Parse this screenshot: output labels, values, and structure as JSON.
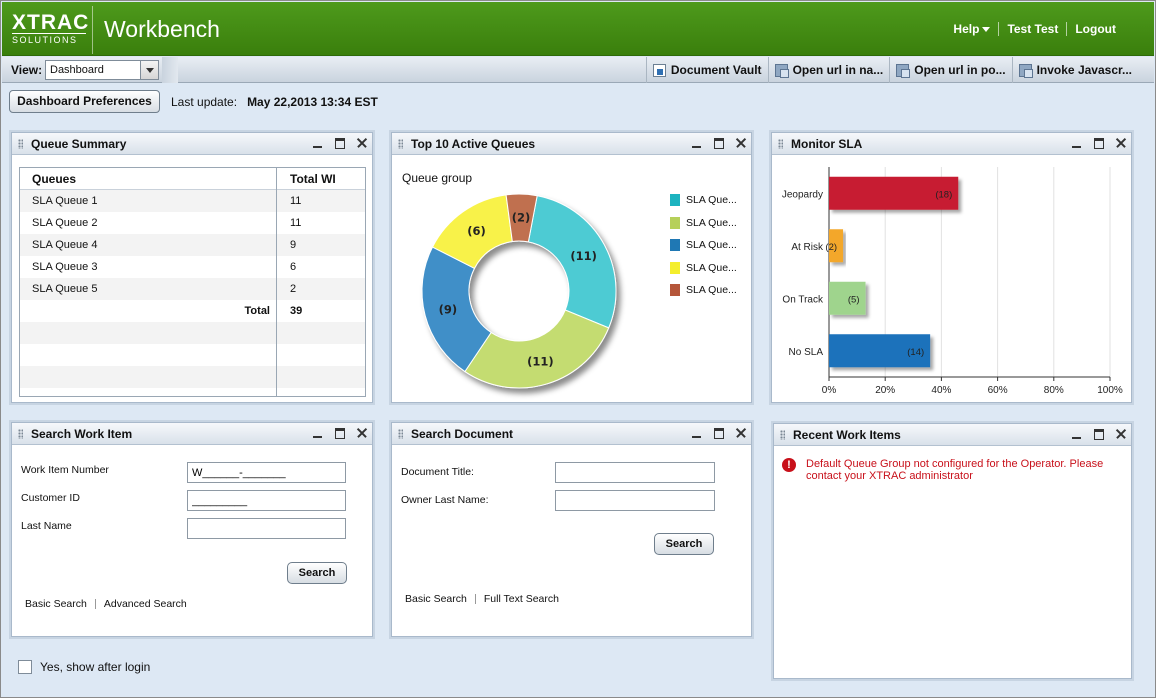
{
  "header": {
    "logo_top": "XTRAC",
    "logo_bottom": "SOLUTIONS",
    "title": "Workbench",
    "links": {
      "help": "Help",
      "user": "Test Test",
      "logout": "Logout"
    }
  },
  "toolbar": {
    "view_label": "View:",
    "view_value": "Dashboard",
    "actions": [
      "Document Vault",
      "Open url in na...",
      "Open url in po...",
      "Invoke Javascr..."
    ]
  },
  "subbar": {
    "preferences_label": "Dashboard Preferences",
    "last_update_label": "Last update:",
    "last_update_value": "May 22,2013 13:34 EST"
  },
  "queue_summary": {
    "title": "Queue Summary",
    "columns": [
      "Queues",
      "Total WI"
    ],
    "rows": [
      {
        "queue": "SLA Queue 1",
        "total": "11"
      },
      {
        "queue": "SLA Queue 2",
        "total": "11"
      },
      {
        "queue": "SLA Queue 4",
        "total": "9"
      },
      {
        "queue": "SLA Queue 3",
        "total": "6"
      },
      {
        "queue": "SLA Queue 5",
        "total": "2"
      }
    ],
    "total_label": "Total",
    "total_value": "39"
  },
  "top_queues": {
    "title": "Top 10 Active Queues",
    "group_label": "Queue group",
    "legend": [
      "SLA Que...",
      "SLA Que...",
      "SLA Que...",
      "SLA Que...",
      "SLA Que..."
    ]
  },
  "monitor_sla": {
    "title": "Monitor SLA"
  },
  "chart_data": [
    {
      "type": "pie",
      "title": "",
      "group_label": "Queue group",
      "donut": true,
      "categories": [
        "SLA Queue 1",
        "SLA Queue 2",
        "SLA Queue 4",
        "SLA Queue 3",
        "SLA Queue 5"
      ],
      "values": [
        11,
        11,
        9,
        6,
        2
      ],
      "labels": [
        "(11)",
        "(11)",
        "(9)",
        "(6)",
        "(2)"
      ],
      "legend": [
        "SLA Que...",
        "SLA Que...",
        "SLA Que...",
        "SLA Que...",
        "SLA Que..."
      ],
      "colors": [
        "#4ecbd3",
        "#c4dc71",
        "#3f8fc8",
        "#f8f24a",
        "#c0704f"
      ],
      "legend_colors": [
        "#1db3bf",
        "#b6d05a",
        "#1f78b4",
        "#f4ee2c",
        "#b5563a"
      ],
      "legend_position": "right"
    },
    {
      "type": "bar",
      "orientation": "horizontal",
      "title": "",
      "categories": [
        "Jeopardy",
        "At Risk",
        "On Track",
        "No SLA"
      ],
      "values": [
        18,
        2,
        5,
        14
      ],
      "labels": [
        "(18)",
        "(2)",
        "(5)",
        "(14)"
      ],
      "percent": [
        46,
        5,
        13,
        36
      ],
      "colors": [
        "#c71f32",
        "#f3a72a",
        "#9fd48d",
        "#1a72bb"
      ],
      "xticks": [
        "0%",
        "20%",
        "40%",
        "60%",
        "80%",
        "100%"
      ],
      "xlim": [
        0,
        100
      ],
      "grid": true
    }
  ],
  "search_work_item": {
    "title": "Search Work Item",
    "fields": [
      {
        "label": "Work Item Number",
        "value": "W______-_______"
      },
      {
        "label": "Customer ID",
        "value": "_________"
      },
      {
        "label": "Last Name",
        "value": ""
      }
    ],
    "search_button": "Search",
    "links": [
      "Basic Search",
      "Advanced Search"
    ]
  },
  "search_document": {
    "title": "Search Document",
    "fields": [
      {
        "label": "Document Title:",
        "value": ""
      },
      {
        "label": "Owner Last Name:",
        "value": ""
      }
    ],
    "search_button": "Search",
    "links": [
      "Basic Search",
      "Full Text Search"
    ]
  },
  "recent_work_items": {
    "title": "Recent Work Items",
    "error_icon": "!",
    "error_text": "Default Queue Group not configured for the Operator. Please contact your XTRAC administrator"
  },
  "footer": {
    "show_after_login": "Yes, show after login"
  },
  "colors": {
    "header_green": "#3f860f",
    "error_red": "#c8101a"
  }
}
